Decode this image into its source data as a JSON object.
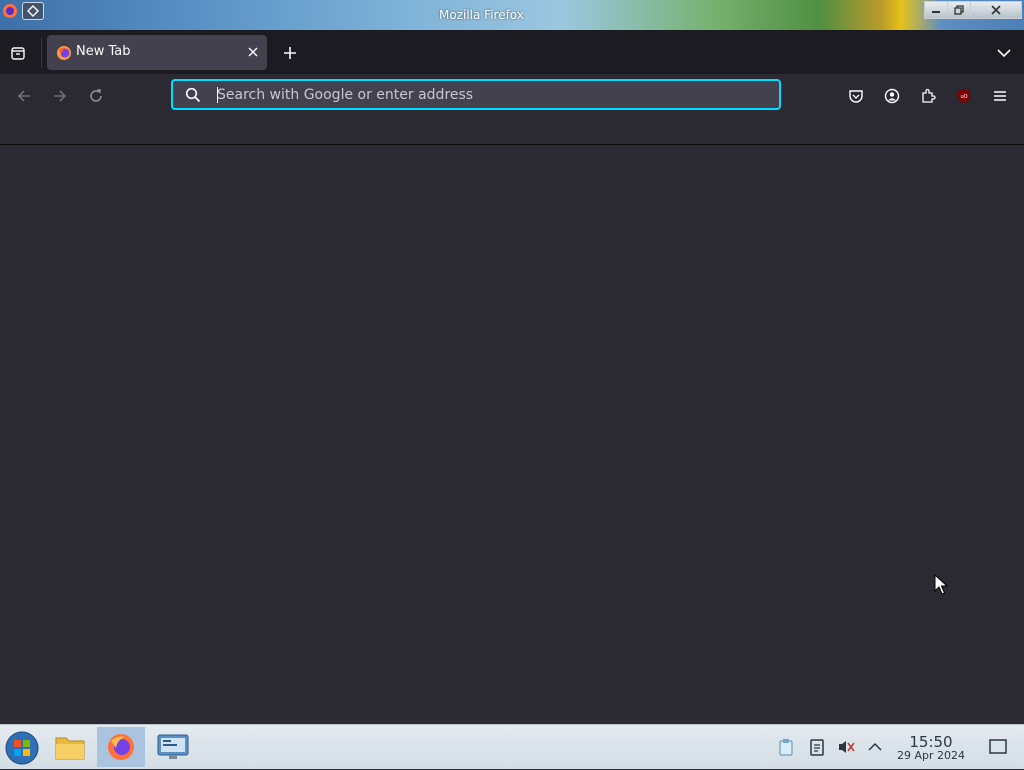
{
  "window": {
    "title": "Mozilla Firefox"
  },
  "tabs": [
    {
      "label": "New Tab"
    }
  ],
  "urlbar": {
    "placeholder": "Search with Google or enter address",
    "value": ""
  },
  "toolbar_icons": [
    "pocket-icon",
    "account-icon",
    "extensions-icon",
    "ublock-origin-icon",
    "menu-icon"
  ],
  "taskbar": {
    "apps": [
      "file-manager",
      "firefox",
      "system-settings"
    ],
    "clock": {
      "time": "15:50",
      "date": "29 Apr 2024"
    }
  },
  "colors": {
    "accent": "#00ddff",
    "tab_active": "#42414d",
    "tabstrip": "#1c1b22",
    "content": "#2b2a33"
  }
}
